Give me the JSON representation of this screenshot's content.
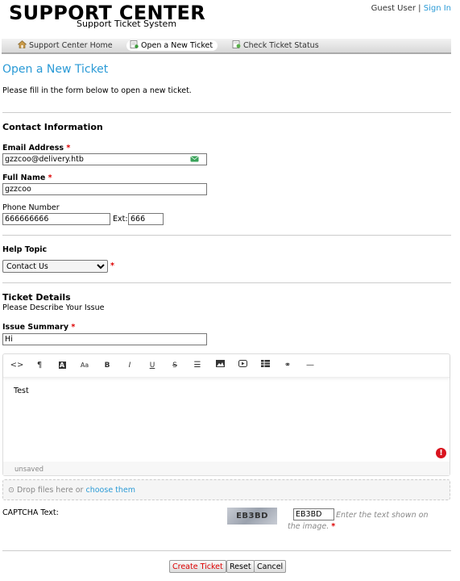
{
  "header": {
    "logo_title": "SUPPORT CENTER",
    "logo_subtitle": "Support Ticket System",
    "guest_user": "Guest User",
    "separator": "|",
    "sign_in": "Sign In"
  },
  "nav": {
    "items": [
      {
        "label": "Support Center Home",
        "icon": "home-icon"
      },
      {
        "label": "Open a New Ticket",
        "icon": "new-ticket-icon",
        "active": true
      },
      {
        "label": "Check Ticket Status",
        "icon": "ticket-status-icon"
      }
    ]
  },
  "page": {
    "title": "Open a New Ticket",
    "intro": "Please fill in the form below to open a new ticket."
  },
  "contact": {
    "heading": "Contact Information",
    "email_label": "Email Address",
    "email_value": "gzzcoo@delivery.htb",
    "name_label": "Full Name",
    "name_value": "gzzcoo",
    "phone_label": "Phone Number",
    "phone_value": "666666666",
    "ext_label": "Ext:",
    "ext_value": "666",
    "required_mark": "*"
  },
  "help_topic": {
    "heading": "Help Topic",
    "selected": "Contact Us"
  },
  "ticket": {
    "heading": "Ticket Details",
    "subheading": "Please Describe Your Issue",
    "summary_label": "Issue Summary",
    "summary_value": "Hi",
    "body_text": "Test",
    "draft_status": "unsaved",
    "toolbar": [
      "html-icon",
      "paragraph-icon",
      "font-color-icon",
      "font-size-icon",
      "bold-icon",
      "italic-icon",
      "underline-icon",
      "strikethrough-icon",
      "list-icon",
      "image-icon",
      "video-icon",
      "table-icon",
      "link-icon",
      "horizontal-rule-icon"
    ]
  },
  "attachments": {
    "drop_text": "Drop files here or",
    "choose_link": "choose them"
  },
  "captcha": {
    "label": "CAPTCHA Text:",
    "image_text": "EB3BD",
    "input_value": "EB3BD",
    "hint": "Enter the text shown on the image."
  },
  "buttons": {
    "create": "Create Ticket",
    "reset": "Reset",
    "cancel": "Cancel"
  },
  "colors": {
    "accent": "#2a9ad6",
    "required": "#dd0000",
    "error": "#d9141e"
  }
}
